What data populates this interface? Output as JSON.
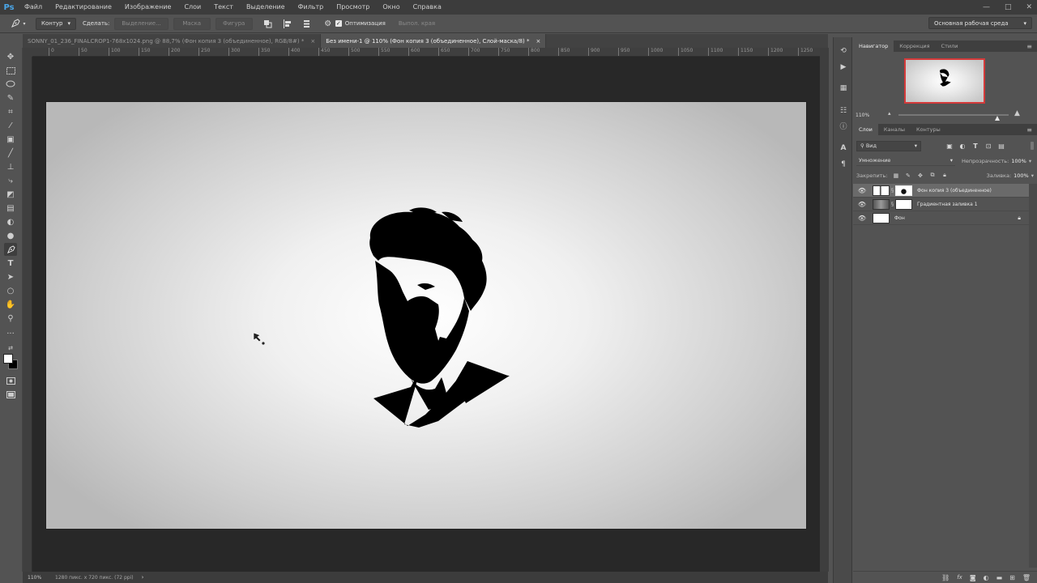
{
  "app": {
    "logo": "Ps"
  },
  "menu": [
    "Файл",
    "Редактирование",
    "Изображение",
    "Слои",
    "Текст",
    "Выделение",
    "Фильтр",
    "Просмотр",
    "Окно",
    "Справка"
  ],
  "window_controls": [
    "—",
    "□",
    "✕"
  ],
  "options": {
    "mode": "Контур",
    "make_label": "Сделать:",
    "selection_btn": "Выделение...",
    "mask_btn": "Маска",
    "shape_btn": "Фигура",
    "optimize_label": "Оптимизация",
    "optimize_checked": true,
    "align_edges": "Выпол. края",
    "workspace": "Основная рабочая среда"
  },
  "tabs": [
    {
      "label": "SONNY_01_236_FINALCROP1-768x1024.png @ 88,7% (Фон копия 3 (объединенное), RGB/8#) *",
      "close": "×",
      "active": false
    },
    {
      "label": "Без имени-1 @ 110% (Фон копия 3 (объединенное), Слой-маска/8) *",
      "close": "×",
      "active": true
    }
  ],
  "ruler": {
    "ticks": [
      "0",
      "50",
      "100",
      "150",
      "200",
      "250",
      "300",
      "350",
      "400",
      "450",
      "500",
      "550",
      "600",
      "650",
      "700",
      "750",
      "800",
      "850",
      "900",
      "950",
      "1000",
      "1050",
      "1100",
      "1150",
      "1200",
      "1250"
    ]
  },
  "status": {
    "zoom": "110%",
    "info": "1280 пикс. x 720 пикс. (72 ppi)",
    "arrow": "›"
  },
  "navigator": {
    "tabs": [
      "Навигатор",
      "Коррекция",
      "Стили"
    ],
    "active_tab": 0,
    "zoom": "110%",
    "zoom_fraction": 0.9
  },
  "layers_panel": {
    "tabs": [
      "Слои",
      "Каналы",
      "Контуры"
    ],
    "active_tab": 0,
    "filter": "Вид",
    "blend_mode": "Умножение",
    "opacity_label": "Непрозрачность:",
    "opacity": "100%",
    "lock_label": "Закрепить:",
    "fill_label": "Заливка:",
    "fill": "100%",
    "layers": [
      {
        "name": "Фон копия 3 (объединенное)",
        "visible": true,
        "selected": true,
        "has_mask": true,
        "locked": false
      },
      {
        "name": "Градиентная заливка 1",
        "visible": true,
        "selected": false,
        "has_mask": true,
        "locked": false
      },
      {
        "name": "Фон",
        "visible": true,
        "selected": false,
        "has_mask": false,
        "locked": true
      }
    ]
  },
  "colors": {
    "foreground": "#ffffff",
    "background": "#000000",
    "accent_nav_frame": "#d43a3a"
  }
}
